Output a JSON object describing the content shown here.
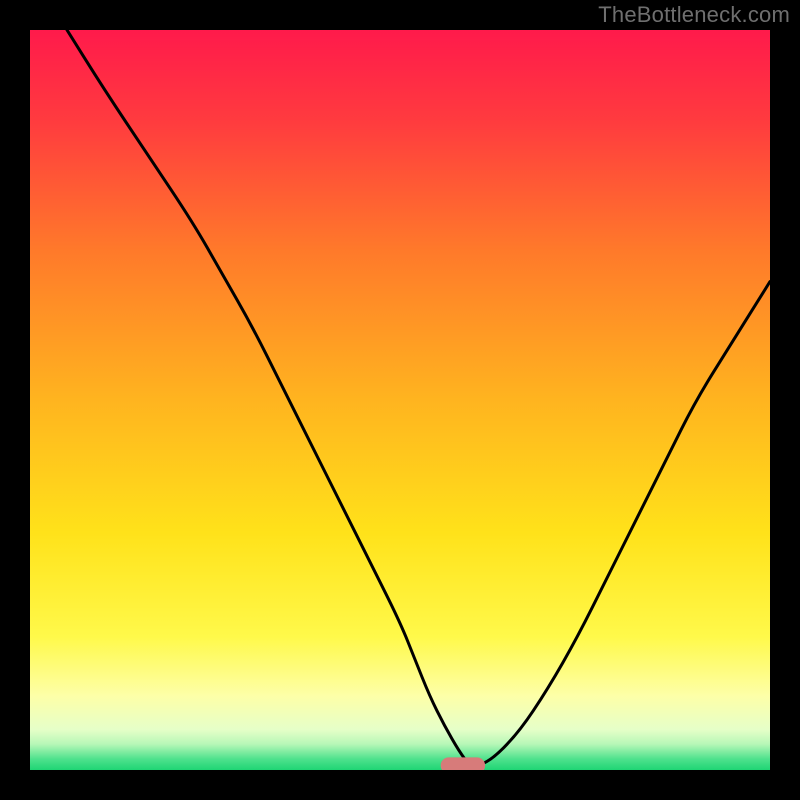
{
  "watermark": "TheBottleneck.com",
  "colors": {
    "frame": "#000000",
    "watermark": "#6f6f6f",
    "curve": "#000000",
    "marker_fill": "#d77b7a",
    "gradient_stops": [
      {
        "offset": 0.0,
        "color": "#ff1a4b"
      },
      {
        "offset": 0.12,
        "color": "#ff3a3f"
      },
      {
        "offset": 0.3,
        "color": "#ff7a2a"
      },
      {
        "offset": 0.5,
        "color": "#ffb41f"
      },
      {
        "offset": 0.68,
        "color": "#ffe21a"
      },
      {
        "offset": 0.82,
        "color": "#fff94a"
      },
      {
        "offset": 0.9,
        "color": "#fdffa8"
      },
      {
        "offset": 0.945,
        "color": "#e6ffc8"
      },
      {
        "offset": 0.965,
        "color": "#b7f7b7"
      },
      {
        "offset": 0.985,
        "color": "#4fe28d"
      },
      {
        "offset": 1.0,
        "color": "#1fd574"
      }
    ]
  },
  "chart_data": {
    "type": "line",
    "title": "",
    "xlabel": "",
    "ylabel": "",
    "xlim": [
      0,
      100
    ],
    "ylim": [
      0,
      100
    ],
    "grid": false,
    "legend": false,
    "series": [
      {
        "name": "bottleneck-curve",
        "x": [
          5,
          10,
          16,
          22,
          26,
          30,
          34,
          38,
          42,
          46,
          50,
          52,
          54,
          56,
          58,
          59.5,
          62,
          66,
          70,
          74,
          78,
          82,
          86,
          90,
          95,
          100
        ],
        "y": [
          100,
          92,
          83,
          74,
          67,
          60,
          52,
          44,
          36,
          28,
          20,
          15,
          10,
          6,
          2.5,
          0.5,
          1,
          5,
          11,
          18,
          26,
          34,
          42,
          50,
          58,
          66
        ]
      }
    ],
    "marker": {
      "x_center": 58.5,
      "width": 6,
      "height": 2.2,
      "y": 0.6
    }
  }
}
